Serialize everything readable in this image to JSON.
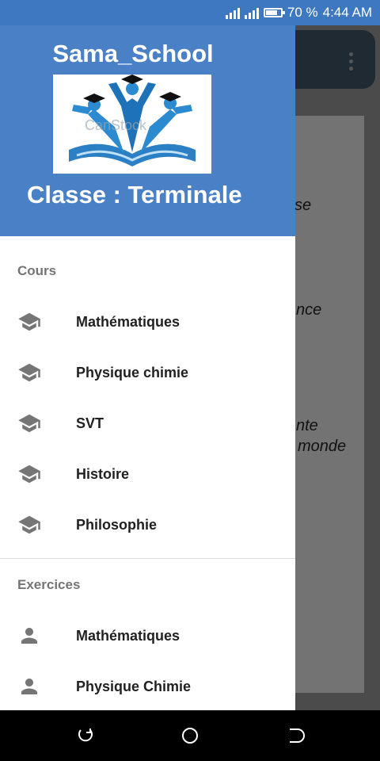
{
  "status_bar": {
    "battery_percent": "70 %",
    "time": "4:44 AM"
  },
  "background": {
    "text_fragments": [
      "se",
      "nce",
      "nte",
      "monde"
    ]
  },
  "drawer": {
    "header": {
      "app_name": "Sama_School",
      "logo_watermark": "CanStock",
      "class_label": "Classe : Terminale"
    },
    "sections": [
      {
        "title": "Cours",
        "icon": "school-icon",
        "items": [
          "Mathématiques",
          "Physique chimie",
          "SVT",
          "Histoire",
          "Philosophie"
        ]
      },
      {
        "title": "Exercices",
        "icon": "person-icon",
        "items": [
          "Mathématiques",
          "Physique Chimie"
        ]
      }
    ]
  },
  "colors": {
    "header_blue": "#4a80c6",
    "status_blue": "#3d78c0",
    "icon_gray": "#757575"
  },
  "nav_bar": {
    "buttons": [
      "recent-apps",
      "home",
      "back"
    ]
  }
}
